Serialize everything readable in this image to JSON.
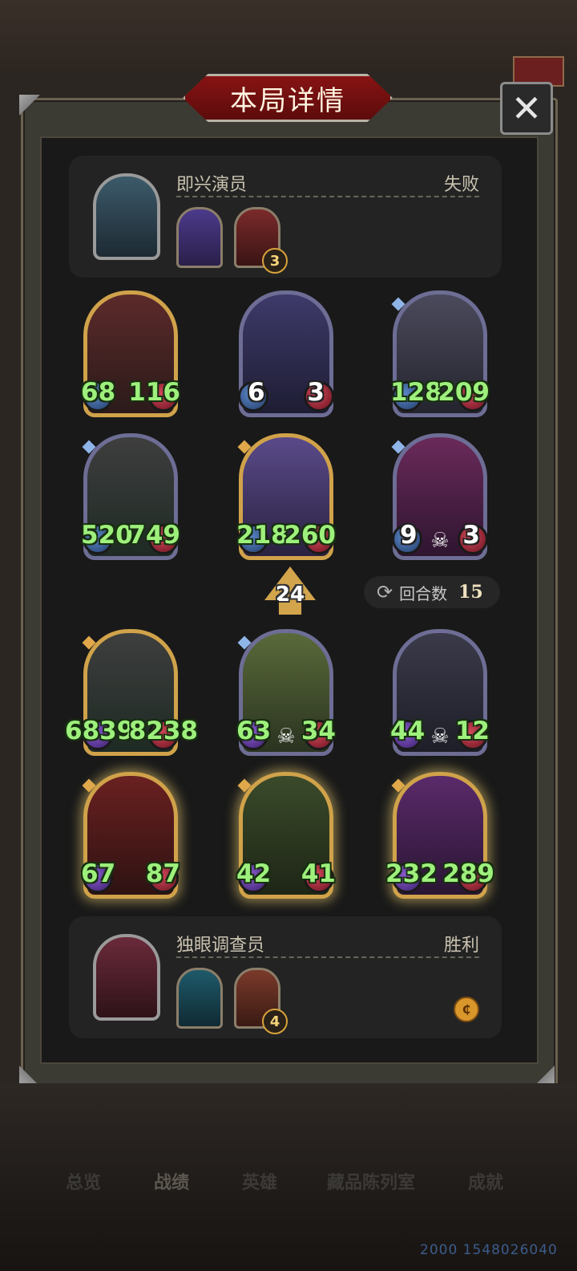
{
  "title": "本局详情",
  "close_label": "✕",
  "opponent": {
    "name": "即兴演员",
    "result": "失败",
    "items": [
      {
        "badge": ""
      },
      {
        "badge": "3"
      }
    ]
  },
  "player": {
    "name": "独眼调查员",
    "result": "胜利",
    "items": [
      {
        "badge": ""
      },
      {
        "badge": "4"
      }
    ]
  },
  "tier_number": "24",
  "rounds": {
    "label": "回合数",
    "value": "15"
  },
  "opponent_board": [
    {
      "atk": "68",
      "hp": "116"
    },
    {
      "atk": "6",
      "hp": "3"
    },
    {
      "atk": "128",
      "hp": "209"
    },
    {
      "atk": "520",
      "hp": "749"
    },
    {
      "atk": "218",
      "hp": "260"
    },
    {
      "atk": "9",
      "hp": "3"
    }
  ],
  "player_board": [
    {
      "atk": "6839",
      "hp": "8238"
    },
    {
      "atk": "63",
      "hp": "34"
    },
    {
      "atk": "44",
      "hp": "12"
    },
    {
      "atk": "67",
      "hp": "87"
    },
    {
      "atk": "42",
      "hp": "41"
    },
    {
      "atk": "232",
      "hp": "289"
    }
  ],
  "tabs": [
    "总览",
    "战绩",
    "英雄",
    "藏品陈列室",
    "成就"
  ],
  "footer_id": "2000 1548026040",
  "colors": {
    "stat_green": "#9ef07c",
    "gold_border": "#d0a24a",
    "silver_border": "#6d6d95",
    "title_red": "#8a1414"
  }
}
